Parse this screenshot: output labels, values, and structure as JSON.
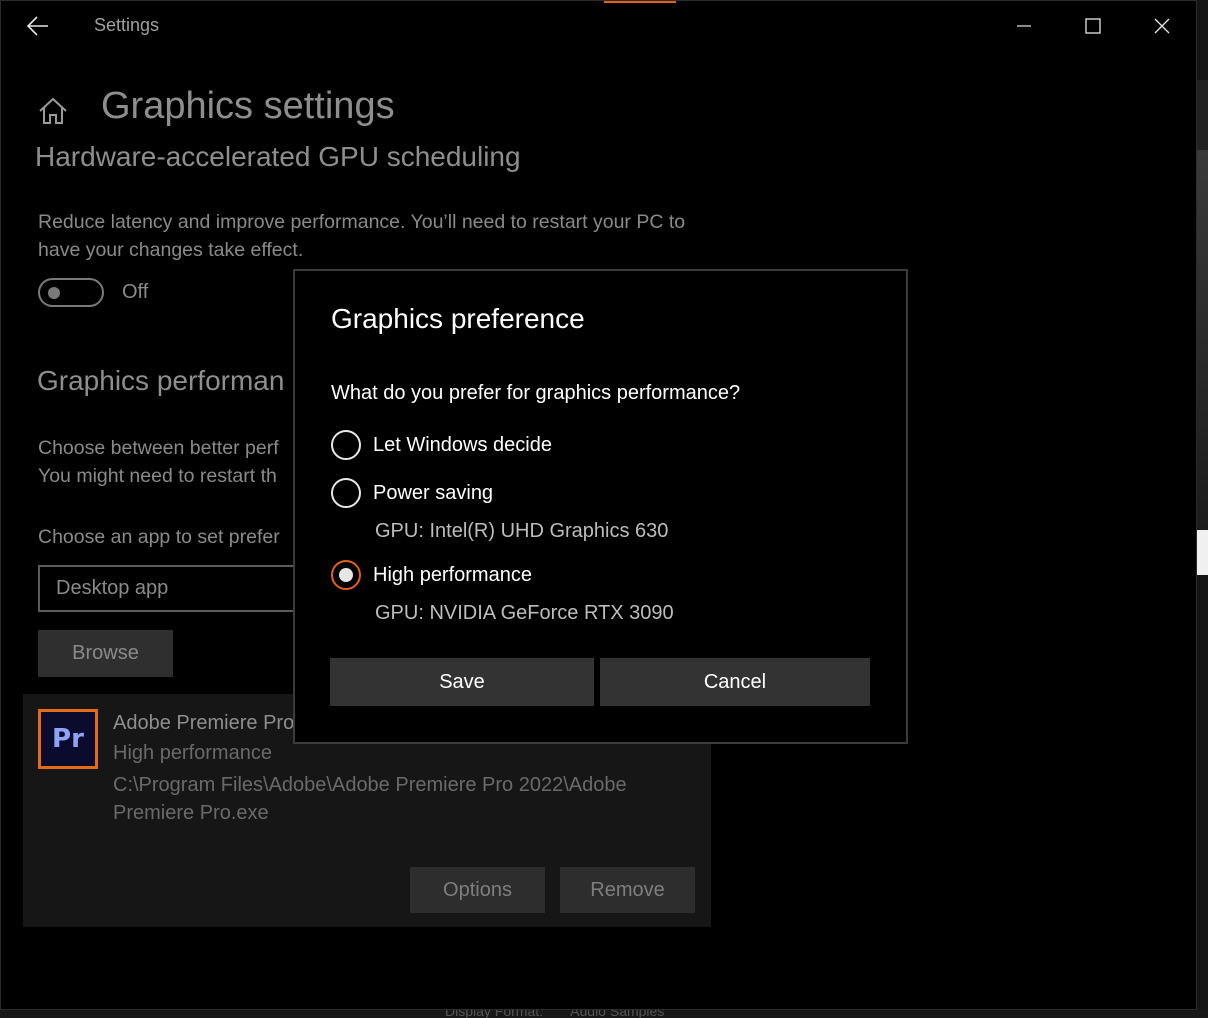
{
  "window": {
    "title": "Settings",
    "controls": {
      "minimize": "minimize-icon",
      "maximize": "maximize-icon",
      "close": "close-icon"
    }
  },
  "page": {
    "title": "Graphics settings",
    "gpu_scheduling": {
      "heading": "Hardware-accelerated GPU scheduling",
      "description": "Reduce latency and improve performance. You’ll need to restart your PC to have your changes take effect.",
      "toggle_state": "Off"
    },
    "performance": {
      "heading": "Graphics performan",
      "description_line1": "Choose between better perf",
      "description_line2": "You might need to restart th",
      "choose_label": "Choose an app to set prefer",
      "app_type_value": "Desktop app",
      "browse_label": "Browse"
    },
    "app_card": {
      "icon_text": "Pr",
      "name": "Adobe Premiere Pro",
      "preference": "High performance",
      "path": "C:\\Program Files\\Adobe\\Adobe Premiere Pro 2022\\Adobe Premiere Pro.exe",
      "options_label": "Options",
      "remove_label": "Remove"
    }
  },
  "dialog": {
    "title": "Graphics preference",
    "question": "What do you prefer for graphics performance?",
    "options": [
      {
        "label": "Let Windows decide",
        "selected": false
      },
      {
        "label": "Power saving",
        "gpu": "GPU: Intel(R) UHD Graphics 630",
        "selected": false
      },
      {
        "label": "High performance",
        "gpu": "GPU: NVIDIA GeForce RTX 3090",
        "selected": true
      }
    ],
    "save_label": "Save",
    "cancel_label": "Cancel"
  },
  "background": {
    "bottom_labels": [
      "Display Format:",
      "Audio Samples"
    ]
  },
  "colors": {
    "accent": "#e2611c",
    "window_bg": "#000000",
    "button_bg": "#333333"
  }
}
